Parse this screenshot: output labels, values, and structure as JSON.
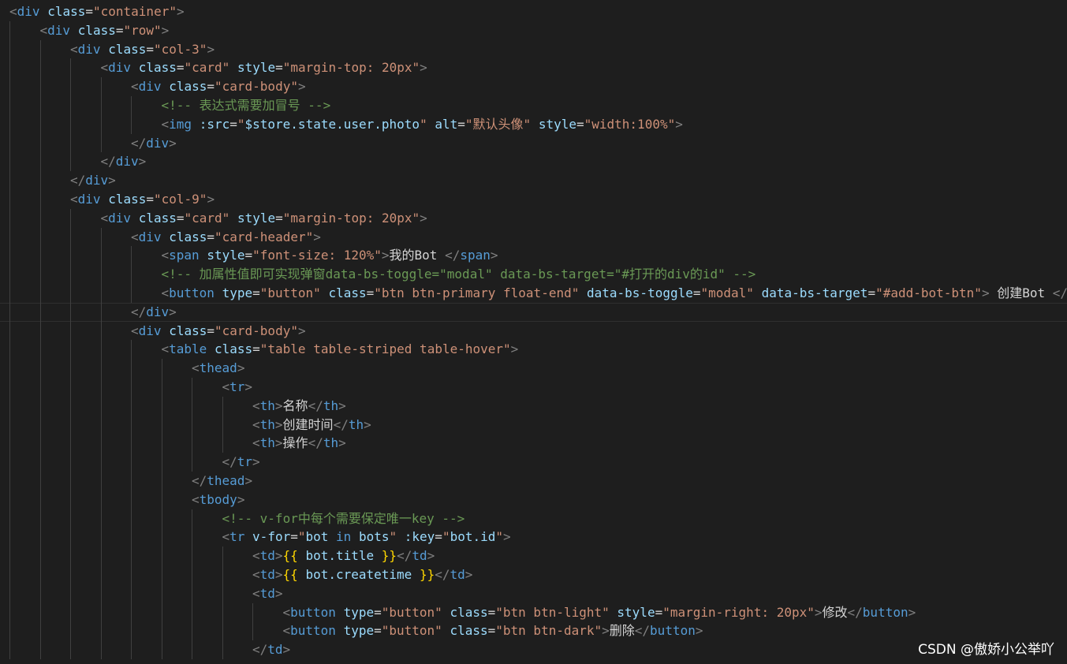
{
  "editor": {
    "lines": [
      {
        "indent": 0,
        "tokens": [
          [
            "punc",
            "<"
          ],
          [
            "tag",
            "div"
          ],
          [
            "txt",
            " "
          ],
          [
            "attr",
            "class"
          ],
          [
            "eq",
            "="
          ],
          [
            "str",
            "\"container\""
          ],
          [
            "punc",
            ">"
          ]
        ]
      },
      {
        "indent": 1,
        "tokens": [
          [
            "punc",
            "<"
          ],
          [
            "tag",
            "div"
          ],
          [
            "txt",
            " "
          ],
          [
            "attr",
            "class"
          ],
          [
            "eq",
            "="
          ],
          [
            "str",
            "\"row\""
          ],
          [
            "punc",
            ">"
          ]
        ]
      },
      {
        "indent": 2,
        "tokens": [
          [
            "punc",
            "<"
          ],
          [
            "tag",
            "div"
          ],
          [
            "txt",
            " "
          ],
          [
            "attr",
            "class"
          ],
          [
            "eq",
            "="
          ],
          [
            "str",
            "\"col-3\""
          ],
          [
            "punc",
            ">"
          ]
        ]
      },
      {
        "indent": 3,
        "tokens": [
          [
            "punc",
            "<"
          ],
          [
            "tag",
            "div"
          ],
          [
            "txt",
            " "
          ],
          [
            "attr",
            "class"
          ],
          [
            "eq",
            "="
          ],
          [
            "str",
            "\"card\""
          ],
          [
            "txt",
            " "
          ],
          [
            "attr",
            "style"
          ],
          [
            "eq",
            "="
          ],
          [
            "str",
            "\"margin-top: 20px\""
          ],
          [
            "punc",
            ">"
          ]
        ]
      },
      {
        "indent": 4,
        "tokens": [
          [
            "punc",
            "<"
          ],
          [
            "tag",
            "div"
          ],
          [
            "txt",
            " "
          ],
          [
            "attr",
            "class"
          ],
          [
            "eq",
            "="
          ],
          [
            "str",
            "\"card-body\""
          ],
          [
            "punc",
            ">"
          ]
        ]
      },
      {
        "indent": 5,
        "tokens": [
          [
            "com",
            "<!-- 表达式需要加冒号 -->"
          ]
        ]
      },
      {
        "indent": 5,
        "tokens": [
          [
            "punc",
            "<"
          ],
          [
            "tag",
            "img"
          ],
          [
            "txt",
            " "
          ],
          [
            "attr",
            ":src"
          ],
          [
            "eq",
            "="
          ],
          [
            "str",
            "\""
          ],
          [
            "var",
            "$store.state.user.photo"
          ],
          [
            "str",
            "\""
          ],
          [
            "txt",
            " "
          ],
          [
            "attr",
            "alt"
          ],
          [
            "eq",
            "="
          ],
          [
            "str",
            "\"默认头像\""
          ],
          [
            "txt",
            " "
          ],
          [
            "attr",
            "style"
          ],
          [
            "eq",
            "="
          ],
          [
            "str",
            "\"width:100%\""
          ],
          [
            "punc",
            ">"
          ]
        ]
      },
      {
        "indent": 4,
        "tokens": [
          [
            "punc",
            "</"
          ],
          [
            "tag",
            "div"
          ],
          [
            "punc",
            ">"
          ]
        ]
      },
      {
        "indent": 3,
        "tokens": [
          [
            "punc",
            "</"
          ],
          [
            "tag",
            "div"
          ],
          [
            "punc",
            ">"
          ]
        ]
      },
      {
        "indent": 2,
        "tokens": [
          [
            "punc",
            "</"
          ],
          [
            "tag",
            "div"
          ],
          [
            "punc",
            ">"
          ]
        ]
      },
      {
        "indent": 2,
        "tokens": [
          [
            "punc",
            "<"
          ],
          [
            "tag",
            "div"
          ],
          [
            "txt",
            " "
          ],
          [
            "attr",
            "class"
          ],
          [
            "eq",
            "="
          ],
          [
            "str",
            "\"col-9\""
          ],
          [
            "punc",
            ">"
          ]
        ]
      },
      {
        "indent": 3,
        "tokens": [
          [
            "punc",
            "<"
          ],
          [
            "tag",
            "div"
          ],
          [
            "txt",
            " "
          ],
          [
            "attr",
            "class"
          ],
          [
            "eq",
            "="
          ],
          [
            "str",
            "\"card\""
          ],
          [
            "txt",
            " "
          ],
          [
            "attr",
            "style"
          ],
          [
            "eq",
            "="
          ],
          [
            "str",
            "\"margin-top: 20px\""
          ],
          [
            "punc",
            ">"
          ]
        ]
      },
      {
        "indent": 4,
        "tokens": [
          [
            "punc",
            "<"
          ],
          [
            "tag",
            "div"
          ],
          [
            "txt",
            " "
          ],
          [
            "attr",
            "class"
          ],
          [
            "eq",
            "="
          ],
          [
            "str",
            "\"card-header\""
          ],
          [
            "punc",
            ">"
          ]
        ]
      },
      {
        "indent": 5,
        "tokens": [
          [
            "punc",
            "<"
          ],
          [
            "tag",
            "span"
          ],
          [
            "txt",
            " "
          ],
          [
            "attr",
            "style"
          ],
          [
            "eq",
            "="
          ],
          [
            "str",
            "\"font-size: 120%\""
          ],
          [
            "punc",
            ">"
          ],
          [
            "txt",
            "我的Bot "
          ],
          [
            "punc",
            "</"
          ],
          [
            "tag",
            "span"
          ],
          [
            "punc",
            ">"
          ]
        ]
      },
      {
        "indent": 5,
        "tokens": [
          [
            "com",
            "<!-- 加属性值即可实现弹窗data-bs-toggle=\"modal\" data-bs-target=\"#打开的div的id\" -->"
          ]
        ]
      },
      {
        "indent": 5,
        "tokens": [
          [
            "punc",
            "<"
          ],
          [
            "tag",
            "button"
          ],
          [
            "txt",
            " "
          ],
          [
            "attr",
            "type"
          ],
          [
            "eq",
            "="
          ],
          [
            "str",
            "\"button\""
          ],
          [
            "txt",
            " "
          ],
          [
            "attr",
            "class"
          ],
          [
            "eq",
            "="
          ],
          [
            "str",
            "\"btn btn-primary float-end\""
          ],
          [
            "txt",
            " "
          ],
          [
            "attr",
            "data-bs-toggle"
          ],
          [
            "eq",
            "="
          ],
          [
            "str",
            "\"modal\""
          ],
          [
            "txt",
            " "
          ],
          [
            "attr",
            "data-bs-target"
          ],
          [
            "eq",
            "="
          ],
          [
            "str",
            "\"#add-bot-btn\""
          ],
          [
            "punc",
            ">"
          ],
          [
            "txt",
            " 创建Bot "
          ],
          [
            "punc",
            "</"
          ],
          [
            "tag",
            "button"
          ],
          [
            "punc",
            ">"
          ]
        ]
      },
      {
        "indent": 4,
        "current": true,
        "tokens": [
          [
            "punc",
            "</"
          ],
          [
            "tag",
            "div"
          ],
          [
            "punc",
            ">"
          ]
        ]
      },
      {
        "indent": 4,
        "tokens": [
          [
            "punc",
            "<"
          ],
          [
            "tag",
            "div"
          ],
          [
            "txt",
            " "
          ],
          [
            "attr",
            "class"
          ],
          [
            "eq",
            "="
          ],
          [
            "str",
            "\"card-body\""
          ],
          [
            "punc",
            ">"
          ]
        ]
      },
      {
        "indent": 5,
        "tokens": [
          [
            "punc",
            "<"
          ],
          [
            "tag",
            "table"
          ],
          [
            "txt",
            " "
          ],
          [
            "attr",
            "class"
          ],
          [
            "eq",
            "="
          ],
          [
            "str",
            "\"table table-striped table-hover\""
          ],
          [
            "punc",
            ">"
          ]
        ]
      },
      {
        "indent": 6,
        "tokens": [
          [
            "punc",
            "<"
          ],
          [
            "tag",
            "thead"
          ],
          [
            "punc",
            ">"
          ]
        ]
      },
      {
        "indent": 7,
        "tokens": [
          [
            "punc",
            "<"
          ],
          [
            "tag",
            "tr"
          ],
          [
            "punc",
            ">"
          ]
        ]
      },
      {
        "indent": 8,
        "tokens": [
          [
            "punc",
            "<"
          ],
          [
            "tag",
            "th"
          ],
          [
            "punc",
            ">"
          ],
          [
            "txt",
            "名称"
          ],
          [
            "punc",
            "</"
          ],
          [
            "tag",
            "th"
          ],
          [
            "punc",
            ">"
          ]
        ]
      },
      {
        "indent": 8,
        "tokens": [
          [
            "punc",
            "<"
          ],
          [
            "tag",
            "th"
          ],
          [
            "punc",
            ">"
          ],
          [
            "txt",
            "创建时间"
          ],
          [
            "punc",
            "</"
          ],
          [
            "tag",
            "th"
          ],
          [
            "punc",
            ">"
          ]
        ]
      },
      {
        "indent": 8,
        "tokens": [
          [
            "punc",
            "<"
          ],
          [
            "tag",
            "th"
          ],
          [
            "punc",
            ">"
          ],
          [
            "txt",
            "操作"
          ],
          [
            "punc",
            "</"
          ],
          [
            "tag",
            "th"
          ],
          [
            "punc",
            ">"
          ]
        ]
      },
      {
        "indent": 7,
        "tokens": [
          [
            "punc",
            "</"
          ],
          [
            "tag",
            "tr"
          ],
          [
            "punc",
            ">"
          ]
        ]
      },
      {
        "indent": 6,
        "tokens": [
          [
            "punc",
            "</"
          ],
          [
            "tag",
            "thead"
          ],
          [
            "punc",
            ">"
          ]
        ]
      },
      {
        "indent": 6,
        "tokens": [
          [
            "punc",
            "<"
          ],
          [
            "tag",
            "tbody"
          ],
          [
            "punc",
            ">"
          ]
        ]
      },
      {
        "indent": 7,
        "tokens": [
          [
            "com",
            "<!-- v-for中每个需要保定唯一key -->"
          ]
        ]
      },
      {
        "indent": 7,
        "tokens": [
          [
            "punc",
            "<"
          ],
          [
            "tag",
            "tr"
          ],
          [
            "txt",
            " "
          ],
          [
            "attr",
            "v-for"
          ],
          [
            "eq",
            "="
          ],
          [
            "str",
            "\""
          ],
          [
            "var",
            "bot"
          ],
          [
            "txt",
            " "
          ],
          [
            "key",
            "in"
          ],
          [
            "txt",
            " "
          ],
          [
            "var",
            "bots"
          ],
          [
            "str",
            "\""
          ],
          [
            "txt",
            " "
          ],
          [
            "attr",
            ":key"
          ],
          [
            "eq",
            "="
          ],
          [
            "str",
            "\""
          ],
          [
            "var",
            "bot.id"
          ],
          [
            "str",
            "\""
          ],
          [
            "punc",
            ">"
          ]
        ]
      },
      {
        "indent": 8,
        "tokens": [
          [
            "punc",
            "<"
          ],
          [
            "tag",
            "td"
          ],
          [
            "punc",
            ">"
          ],
          [
            "brace",
            "{{"
          ],
          [
            "txt",
            " "
          ],
          [
            "var",
            "bot.title"
          ],
          [
            "txt",
            " "
          ],
          [
            "brace",
            "}}"
          ],
          [
            "punc",
            "</"
          ],
          [
            "tag",
            "td"
          ],
          [
            "punc",
            ">"
          ]
        ]
      },
      {
        "indent": 8,
        "tokens": [
          [
            "punc",
            "<"
          ],
          [
            "tag",
            "td"
          ],
          [
            "punc",
            ">"
          ],
          [
            "brace",
            "{{"
          ],
          [
            "txt",
            " "
          ],
          [
            "var",
            "bot.createtime"
          ],
          [
            "txt",
            " "
          ],
          [
            "brace",
            "}}"
          ],
          [
            "punc",
            "</"
          ],
          [
            "tag",
            "td"
          ],
          [
            "punc",
            ">"
          ]
        ]
      },
      {
        "indent": 8,
        "tokens": [
          [
            "punc",
            "<"
          ],
          [
            "tag",
            "td"
          ],
          [
            "punc",
            ">"
          ]
        ]
      },
      {
        "indent": 9,
        "tokens": [
          [
            "punc",
            "<"
          ],
          [
            "tag",
            "button"
          ],
          [
            "txt",
            " "
          ],
          [
            "attr",
            "type"
          ],
          [
            "eq",
            "="
          ],
          [
            "str",
            "\"button\""
          ],
          [
            "txt",
            " "
          ],
          [
            "attr",
            "class"
          ],
          [
            "eq",
            "="
          ],
          [
            "str",
            "\"btn btn-light\""
          ],
          [
            "txt",
            " "
          ],
          [
            "attr",
            "style"
          ],
          [
            "eq",
            "="
          ],
          [
            "str",
            "\"margin-right: 20px\""
          ],
          [
            "punc",
            ">"
          ],
          [
            "txt",
            "修改"
          ],
          [
            "punc",
            "</"
          ],
          [
            "tag",
            "button"
          ],
          [
            "punc",
            ">"
          ]
        ]
      },
      {
        "indent": 9,
        "tokens": [
          [
            "punc",
            "<"
          ],
          [
            "tag",
            "button"
          ],
          [
            "txt",
            " "
          ],
          [
            "attr",
            "type"
          ],
          [
            "eq",
            "="
          ],
          [
            "str",
            "\"button\""
          ],
          [
            "txt",
            " "
          ],
          [
            "attr",
            "class"
          ],
          [
            "eq",
            "="
          ],
          [
            "str",
            "\"btn btn-dark\""
          ],
          [
            "punc",
            ">"
          ],
          [
            "txt",
            "删除"
          ],
          [
            "punc",
            "</"
          ],
          [
            "tag",
            "button"
          ],
          [
            "punc",
            ">"
          ]
        ]
      },
      {
        "indent": 8,
        "tokens": [
          [
            "punc",
            "</"
          ],
          [
            "tag",
            "td"
          ],
          [
            "punc",
            ">"
          ]
        ]
      }
    ]
  },
  "watermark": "CSDN @傲娇小公举吖"
}
